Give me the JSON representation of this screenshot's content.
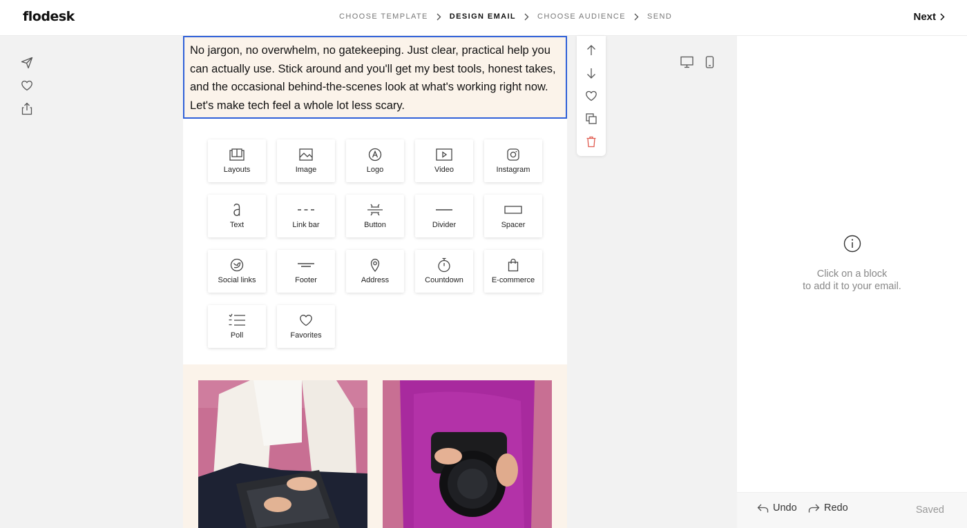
{
  "header": {
    "logo": "flodesk",
    "steps": [
      {
        "label": "Choose template"
      },
      {
        "label": "Design email"
      },
      {
        "label": "Choose audience"
      },
      {
        "label": "Send"
      }
    ],
    "active_step": "Design email",
    "next_label": "Next"
  },
  "left_actions": [
    "send-icon",
    "heart-icon",
    "share-icon"
  ],
  "canvas": {
    "text_block": "No jargon, no overwhelm, no gatekeeping. Just clear, practical help you can actually use. Stick around and you'll get my best tools, honest takes, and the occasional behind-the-scenes look at what's working right now. Let's make tech feel a whole lot less scary.",
    "blocks": [
      {
        "label": "Layouts",
        "icon": "layouts-icon"
      },
      {
        "label": "Image",
        "icon": "image-icon"
      },
      {
        "label": "Logo",
        "icon": "logo-icon"
      },
      {
        "label": "Video",
        "icon": "video-icon"
      },
      {
        "label": "Instagram",
        "icon": "instagram-icon"
      },
      {
        "label": "Text",
        "icon": "text-icon"
      },
      {
        "label": "Link bar",
        "icon": "link-bar-icon"
      },
      {
        "label": "Button",
        "icon": "button-icon"
      },
      {
        "label": "Divider",
        "icon": "divider-icon"
      },
      {
        "label": "Spacer",
        "icon": "spacer-icon"
      },
      {
        "label": "Social links",
        "icon": "social-links-icon"
      },
      {
        "label": "Footer",
        "icon": "footer-icon"
      },
      {
        "label": "Address",
        "icon": "address-icon"
      },
      {
        "label": "Countdown",
        "icon": "countdown-icon"
      },
      {
        "label": "E-commerce",
        "icon": "shopping-bag-icon"
      },
      {
        "label": "Poll",
        "icon": "poll-icon"
      },
      {
        "label": "Favorites",
        "icon": "heart-icon"
      }
    ]
  },
  "block_toolbar": [
    "move-up-icon",
    "move-down-icon",
    "favorite-icon",
    "duplicate-icon",
    "delete-icon"
  ],
  "device_toggle": [
    "desktop-icon",
    "mobile-icon"
  ],
  "right_panel": {
    "hint_line1": "Click on a block",
    "hint_line2": "to add it to your email.",
    "undo_label": "Undo",
    "redo_label": "Redo",
    "status": "Saved"
  },
  "colors": {
    "selection_border": "#2f60d8",
    "canvas_background": "#fbf3ea",
    "delete_red": "#e05a4e",
    "photo_background": "#c86f93"
  }
}
